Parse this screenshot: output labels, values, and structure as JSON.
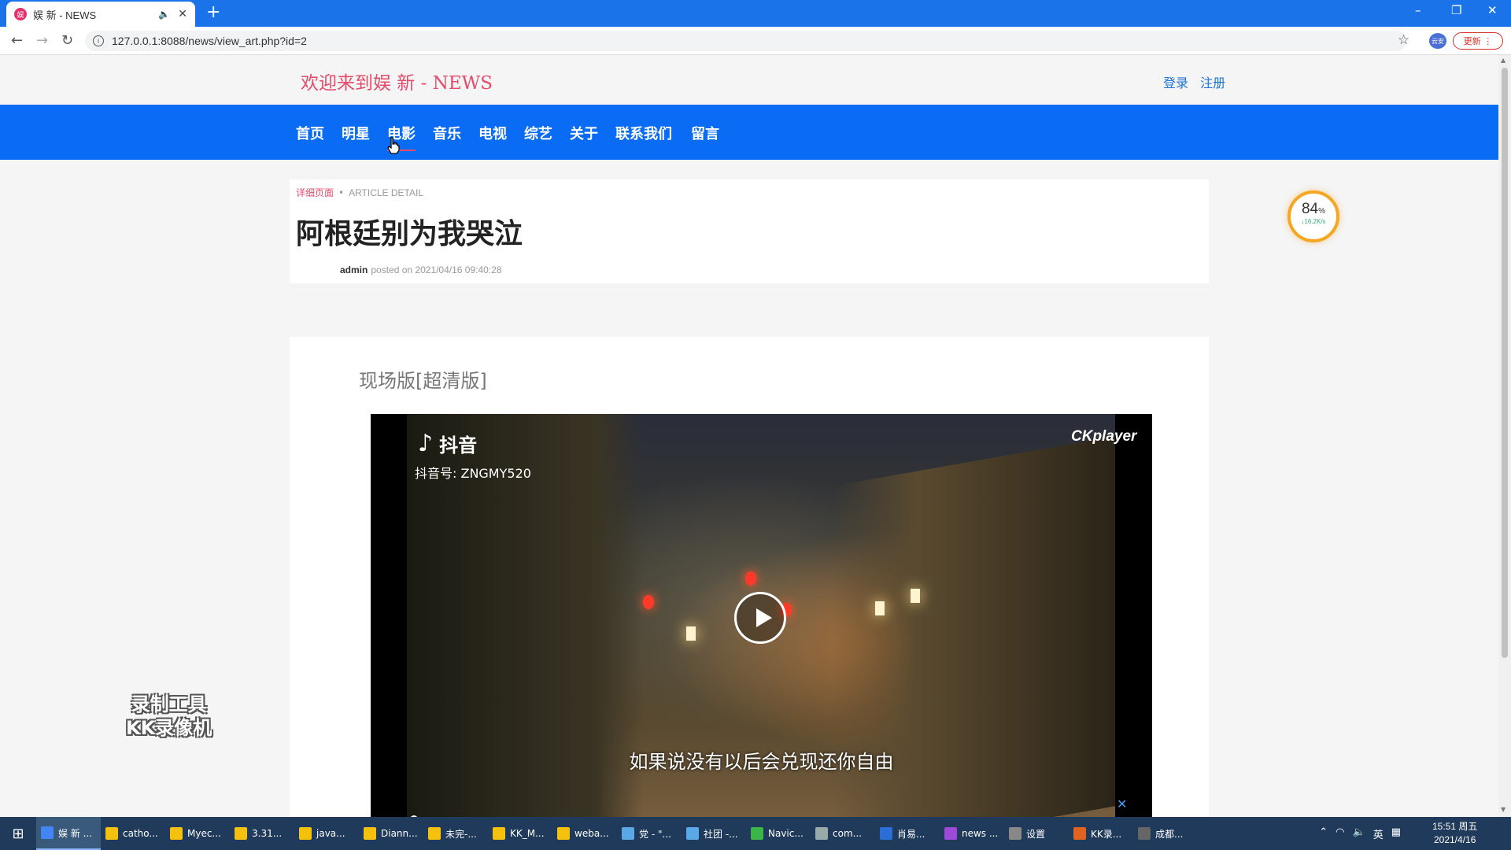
{
  "browser": {
    "tab_title": "娱 新 - NEWS",
    "url": "127.0.0.1:8088/news/view_art.php?id=2",
    "update_label": "更新",
    "profile_label": "云安"
  },
  "site": {
    "logo": "欢迎来到娱 新 - NEWS",
    "login": "登录",
    "register": "注册",
    "nav": [
      "首页",
      "明星",
      "电影",
      "音乐",
      "电视",
      "综艺",
      "关于",
      "联系我们",
      "留言"
    ]
  },
  "article": {
    "breadcrumb_cn": "详细页面",
    "breadcrumb_en": "ARTICLE DETAIL",
    "title": "阿根廷别为我哭泣",
    "author": "admin",
    "posted": "posted on 2021/04/16 09:40:28"
  },
  "video": {
    "section_title": "现场版[超清版]",
    "platform": "抖音",
    "account": "抖音号: ZNGMY520",
    "brand": "CKplayer",
    "subtitle": "如果说没有以后会兑现还你自由",
    "progress": 0.01
  },
  "speed_widget": {
    "percent": "84",
    "rate": "↓16.2K/s"
  },
  "watermark": {
    "line1": "录制工具",
    "line2": "KK录像机"
  },
  "taskbar": {
    "items": [
      "娱 新 ...",
      "catho...",
      "Myec...",
      "3.31...",
      "java...",
      "Diann...",
      "未完-...",
      "KK_M...",
      "weba...",
      "党 - \"...",
      "社团 -...",
      "Navic...",
      "com...",
      "肖易...",
      "news ...",
      "设置",
      "KK录...",
      "成都..."
    ],
    "ime": "英",
    "time": "15:51 周五",
    "date": "2021/4/16"
  },
  "colors": {
    "nav_bg": "#0a6cf5",
    "logo": "#e64b6b",
    "link": "#1e74d6"
  }
}
